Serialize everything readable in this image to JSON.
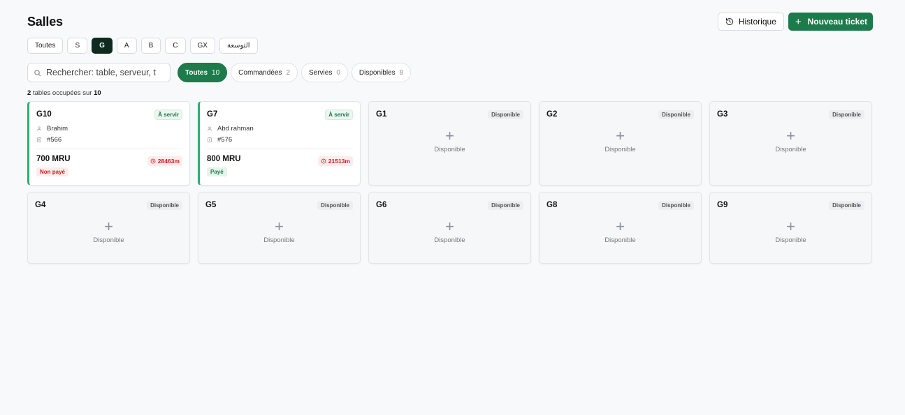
{
  "header": {
    "title": "Salles",
    "history_label": "Historique",
    "new_ticket_label": "Nouveau ticket"
  },
  "room_tabs": [
    {
      "label": "Toutes",
      "active": false
    },
    {
      "label": "S",
      "active": false
    },
    {
      "label": "G",
      "active": true
    },
    {
      "label": "A",
      "active": false
    },
    {
      "label": "B",
      "active": false
    },
    {
      "label": "C",
      "active": false
    },
    {
      "label": "GX",
      "active": false
    },
    {
      "label": "التوسعة",
      "active": false
    }
  ],
  "search": {
    "placeholder": "Rechercher: table, serveur, t"
  },
  "filters": [
    {
      "label": "Toutes",
      "count": "10",
      "active": true
    },
    {
      "label": "Commandées",
      "count": "2",
      "active": false
    },
    {
      "label": "Servies",
      "count": "0",
      "active": false
    },
    {
      "label": "Disponibles",
      "count": "8",
      "active": false
    }
  ],
  "summary": {
    "occupied": "2",
    "middle": "tables occupées sur",
    "total": "10"
  },
  "tables": [
    {
      "name": "G10",
      "status": "À servir",
      "waiter": "Brahim",
      "ticket": "#566",
      "amount": "700 MRU",
      "payment": "Non payé",
      "paid": false,
      "timer": "28463m"
    },
    {
      "name": "G7",
      "status": "À servir",
      "waiter": "Abd rahman",
      "ticket": "#576",
      "amount": "800 MRU",
      "payment": "Payé",
      "paid": true,
      "timer": "21513m"
    }
  ],
  "free_tables": [
    {
      "name": "G1",
      "badge": "Disponible",
      "label": "Disponible"
    },
    {
      "name": "G2",
      "badge": "Disponible",
      "label": "Disponible"
    },
    {
      "name": "G3",
      "badge": "Disponible",
      "label": "Disponible"
    },
    {
      "name": "G4",
      "badge": "Disponible",
      "label": "Disponible"
    },
    {
      "name": "G5",
      "badge": "Disponible",
      "label": "Disponible"
    },
    {
      "name": "G6",
      "badge": "Disponible",
      "label": "Disponible"
    },
    {
      "name": "G8",
      "badge": "Disponible",
      "label": "Disponible"
    },
    {
      "name": "G9",
      "badge": "Disponible",
      "label": "Disponible"
    }
  ],
  "colors": {
    "primary": "#1c7a4b",
    "occupied_border": "#2fae6f",
    "alert": "#c81e1e",
    "active_tab": "#0f2a1f"
  },
  "icons": {
    "history": "history-icon",
    "plus": "plus-icon",
    "search": "search-icon",
    "user": "user-icon",
    "receipt": "receipt-icon",
    "clock": "clock-icon"
  }
}
